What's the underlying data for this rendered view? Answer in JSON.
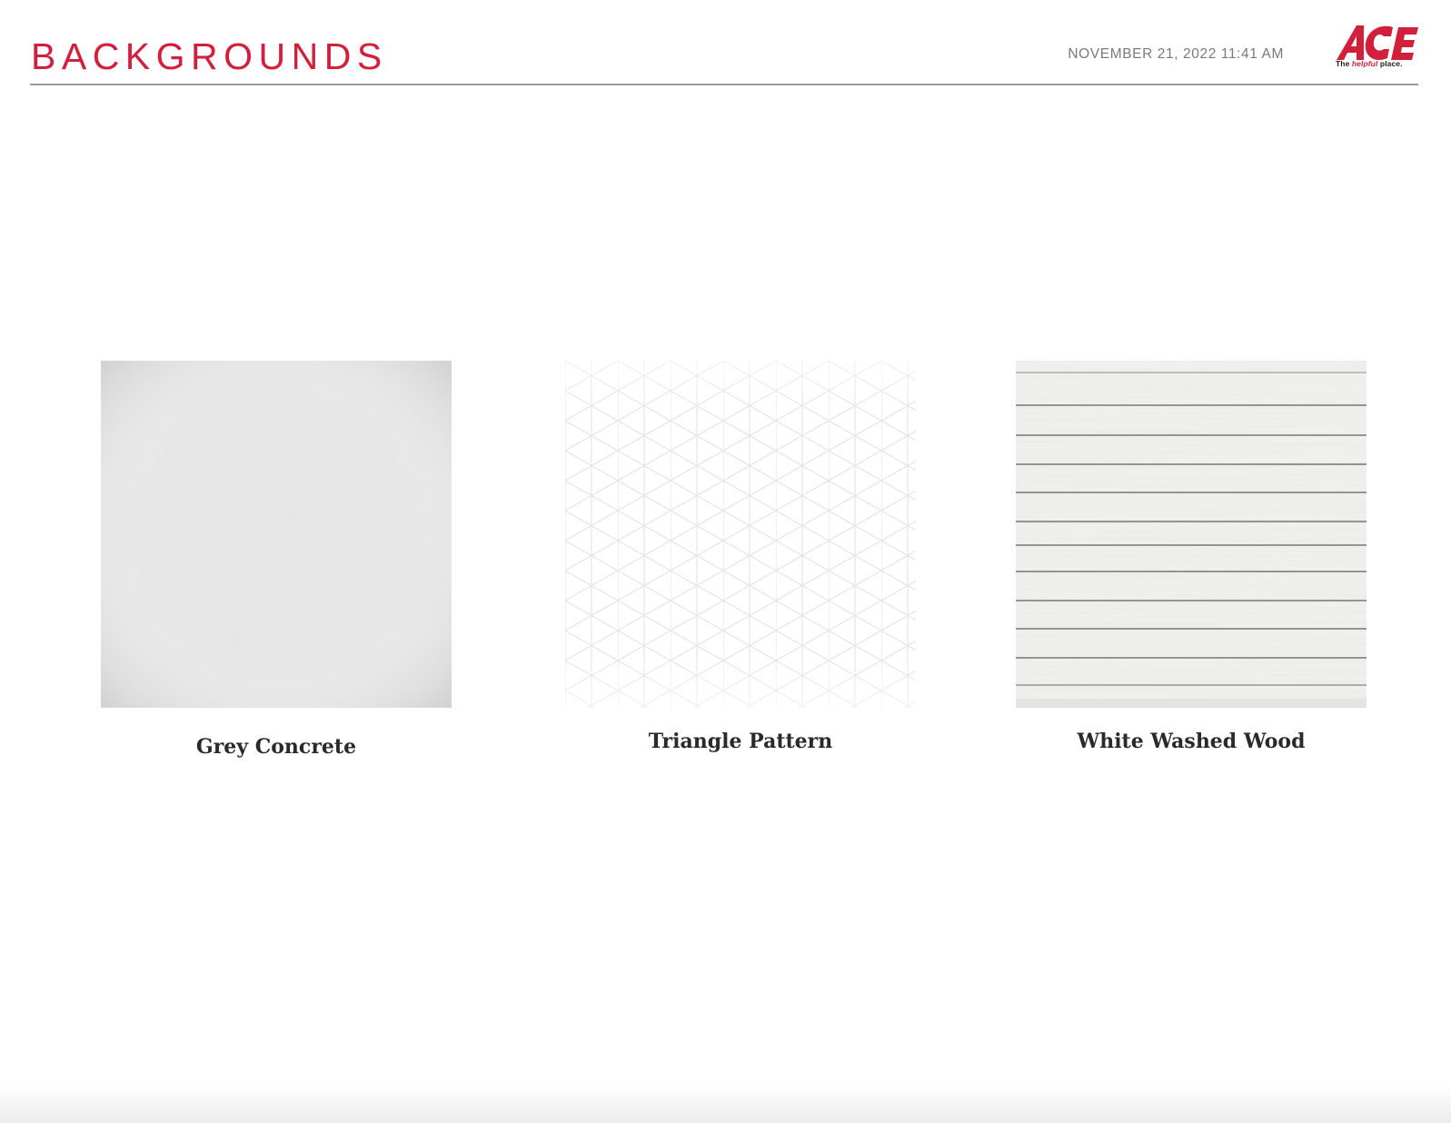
{
  "header": {
    "title": "BACKGROUNDS",
    "timestamp": "NOVEMBER 21, 2022 11:41 AM",
    "logo": {
      "wordmark": "ACE",
      "tagline_prefix": "The ",
      "tagline_accent": "helpful",
      "tagline_suffix": " place."
    }
  },
  "backgrounds": [
    {
      "name": "Grey Concrete",
      "pattern": "concrete"
    },
    {
      "name": "Triangle Pattern",
      "pattern": "triangles"
    },
    {
      "name": "White Washed Wood",
      "pattern": "wood-planks"
    }
  ],
  "colors": {
    "brand_red": "#d21f3c",
    "header_rule": "#9a9a9a",
    "caption_text": "#2a2a2a"
  }
}
